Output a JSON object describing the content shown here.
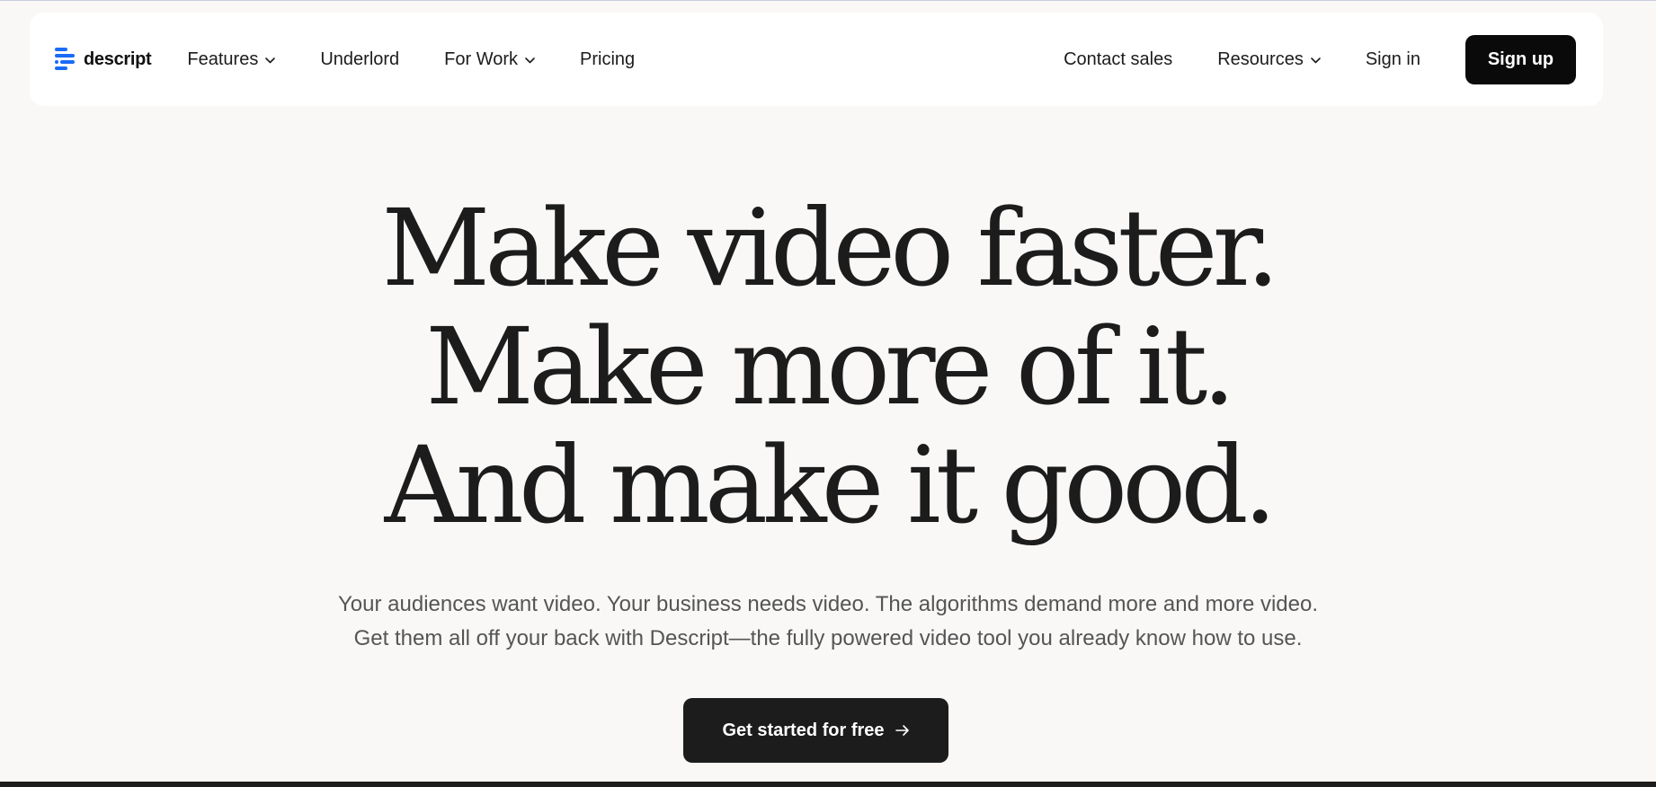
{
  "nav": {
    "logo_text": "descript",
    "left_items": [
      {
        "label": "Features",
        "has_dropdown": true
      },
      {
        "label": "Underlord",
        "has_dropdown": false
      },
      {
        "label": "For Work",
        "has_dropdown": true
      },
      {
        "label": "Pricing",
        "has_dropdown": false
      }
    ],
    "right_items": [
      {
        "label": "Contact sales",
        "has_dropdown": false
      },
      {
        "label": "Resources",
        "has_dropdown": true
      },
      {
        "label": "Sign in",
        "has_dropdown": false
      }
    ],
    "signup_label": "Sign up"
  },
  "hero": {
    "headline_lines": [
      "Make video faster.",
      "Make more of it.",
      "And make it good."
    ],
    "subheadline_lines": [
      "Your audiences want video. Your business needs video. The algorithms demand more and more video.",
      "Get them all off your back with Descript—the fully powered video tool you already know how to use."
    ],
    "cta_label": "Get started for free"
  },
  "colors": {
    "background": "#f9f8f7",
    "nav_background": "#ffffff",
    "primary_button": "#0a0a0a",
    "logo_blue": "#1a6bf5",
    "text": "#1c1c1c",
    "subtext": "#555555"
  },
  "icons": {
    "logo": "descript-logo-icon",
    "dropdown": "chevron-down-icon",
    "cta": "arrow-right-icon"
  }
}
